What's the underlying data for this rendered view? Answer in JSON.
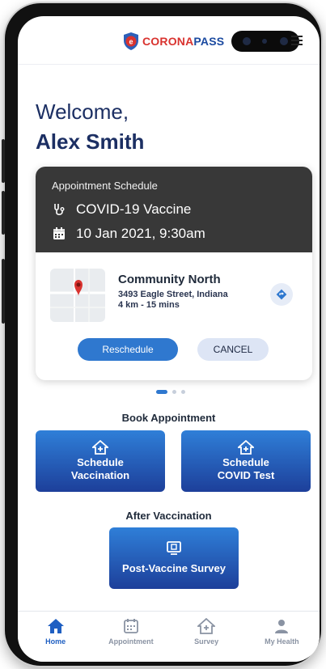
{
  "header": {
    "logo_letter": "e",
    "logo_corona": "CORONA",
    "logo_pass": "PASS"
  },
  "welcome": {
    "greeting": "Welcome,",
    "name": "Alex Smith"
  },
  "appointment": {
    "heading": "Appointment Schedule",
    "vaccine": "COVID-19 Vaccine",
    "datetime": "10 Jan 2021, 9:30am",
    "location_name": "Community North",
    "address": "3493 Eagle Street, Indiana",
    "distance": "4 km - 15 mins",
    "reschedule_label": "Reschedule",
    "cancel_label": "CANCEL"
  },
  "carousel": {
    "count": 3,
    "active_index": 0
  },
  "book": {
    "title": "Book Appointment",
    "vaccination_label": "Schedule Vaccination",
    "covid_test_label": "Schedule COVID Test"
  },
  "after": {
    "title": "After Vaccination",
    "survey_label": "Post-Vaccine Survey"
  },
  "nav": {
    "items": [
      {
        "label": "Home",
        "icon": "home-icon",
        "active": true
      },
      {
        "label": "Appointment",
        "icon": "calendar-icon",
        "active": false
      },
      {
        "label": "Survey",
        "icon": "survey-home-icon",
        "active": false
      },
      {
        "label": "My Health",
        "icon": "person-icon",
        "active": false
      }
    ]
  },
  "colors": {
    "primary": "#2f78cf",
    "dark_blue": "#1c2f63",
    "card_header": "#383838",
    "logo_red": "#d9332f"
  }
}
